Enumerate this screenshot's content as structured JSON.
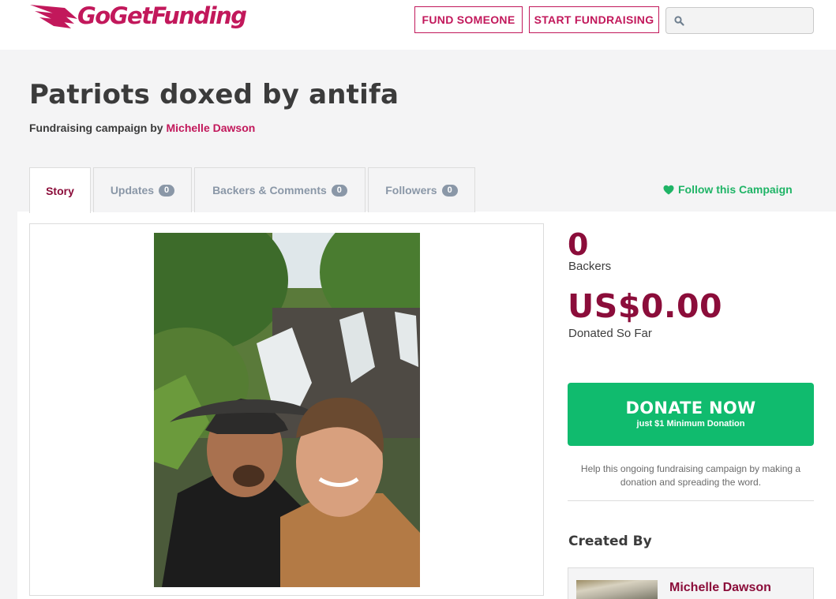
{
  "brand": {
    "name": "GoGetFunding",
    "color": "#c2185b",
    "logo_icon": "winged-logo-icon"
  },
  "header": {
    "fund_label": "FUND SOMEONE",
    "start_label": "START FUNDRAISING",
    "search": {
      "placeholder": "",
      "value": "",
      "icon": "search-icon"
    }
  },
  "campaign": {
    "title": "Patriots doxed by antifa",
    "subtitle_prefix": "Fundraising campaign by",
    "organizer": "Michelle Dawson"
  },
  "tabs": [
    {
      "label": "Story",
      "count": null,
      "active": true
    },
    {
      "label": "Updates",
      "count": "0",
      "active": false
    },
    {
      "label": "Backers & Comments",
      "count": "0",
      "active": false
    },
    {
      "label": "Followers",
      "count": "0",
      "active": false
    }
  ],
  "follow": {
    "label": "Follow this Campaign",
    "icon": "heart-icon",
    "color": "#1fb466"
  },
  "stats": {
    "backers": "0",
    "backers_label": "Backers",
    "amount": "US$0.00",
    "amount_label": "Donated So Far"
  },
  "donate": {
    "label": "DONATE NOW",
    "sublabel": "just $1 Minimum Donation",
    "color": "#10bb6e"
  },
  "help_text": "Help this ongoing fundraising campaign by making a donation and spreading the word.",
  "created_by": {
    "heading": "Created By",
    "name": "Michelle Dawson"
  },
  "colors": {
    "accent": "#8b0d3a",
    "tab_inactive": "#8a97a7"
  }
}
